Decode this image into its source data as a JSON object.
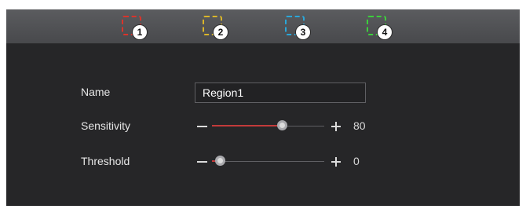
{
  "regions": [
    {
      "number": "1",
      "color": "#d9342b"
    },
    {
      "number": "2",
      "color": "#d9b52a"
    },
    {
      "number": "3",
      "color": "#2aa7d9"
    },
    {
      "number": "4",
      "color": "#3ccf3c"
    }
  ],
  "form": {
    "name_label": "Name",
    "name_value": "Region1",
    "sensitivity_label": "Sensitivity",
    "sensitivity_value": "80",
    "sensitivity_level": 0.62,
    "threshold_label": "Threshold",
    "threshold_value": "0",
    "threshold_level": 0.07
  }
}
